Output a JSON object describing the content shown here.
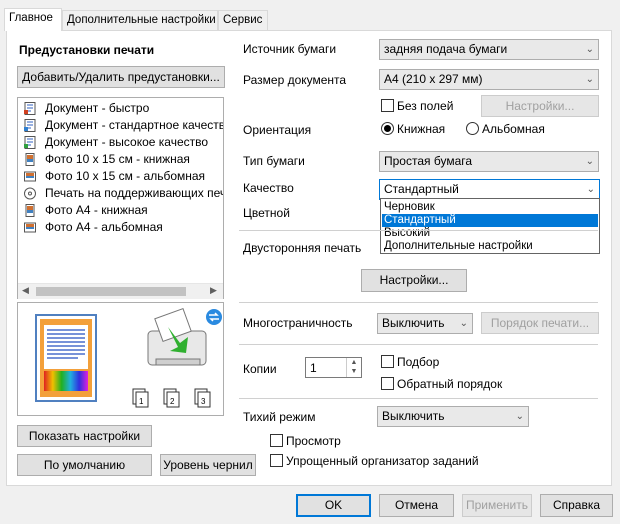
{
  "tabs": [
    "Главное",
    "Дополнительные настройки",
    "Сервис"
  ],
  "presets": {
    "title": "Предустановки печати",
    "add_button": "Добавить/Удалить предустановки...",
    "items": [
      "Документ - быстро",
      "Документ - стандартное качество",
      "Документ - высокое качество",
      "Фото 10 x 15 см - книжная",
      "Фото 10 x 15 см - альбомная",
      "Печать на поддерживающих печат",
      "Фото A4 - книжная",
      "Фото A4 - альбомная"
    ]
  },
  "left_buttons": {
    "show_settings": "Показать настройки",
    "defaults": "По умолчанию",
    "ink_levels": "Уровень чернил"
  },
  "paper_source": {
    "label": "Источник бумаги",
    "value": "задняя подача бумаги"
  },
  "paper_size": {
    "label": "Размер документа",
    "value": "A4 (210 x 297 мм)"
  },
  "borderless": {
    "label": "Без полей",
    "settings_button": "Настройки..."
  },
  "orientation": {
    "label": "Ориентация",
    "portrait": "Книжная",
    "landscape": "Альбомная"
  },
  "paper_type": {
    "label": "Тип бумаги",
    "value": "Простая бумага"
  },
  "quality": {
    "label": "Качество",
    "value": "Стандартный",
    "options": [
      "Черновик",
      "Стандартный",
      "Высокий",
      "Дополнительные настройки"
    ],
    "selected_index": 1
  },
  "color": {
    "label": "Цветной"
  },
  "duplex": {
    "label": "Двусторонняя печать",
    "settings_button": "Настройки..."
  },
  "multipage": {
    "label": "Многостраничность",
    "value": "Выключить",
    "order_button": "Порядок печати..."
  },
  "copies": {
    "label": "Копии",
    "value": "1",
    "collate": "Подбор",
    "reverse": "Обратный порядок"
  },
  "quiet_mode": {
    "label": "Тихий режим",
    "value": "Выключить"
  },
  "preview": {
    "label": "Просмотр"
  },
  "job_arranger": {
    "label": "Упрощенный организатор заданий"
  },
  "footer": {
    "ok": "OK",
    "cancel": "Отмена",
    "apply": "Применить",
    "help": "Справка"
  },
  "colors": {
    "accent": "#0078d7",
    "panel": "#ffffff",
    "window": "#f0f0f0"
  }
}
